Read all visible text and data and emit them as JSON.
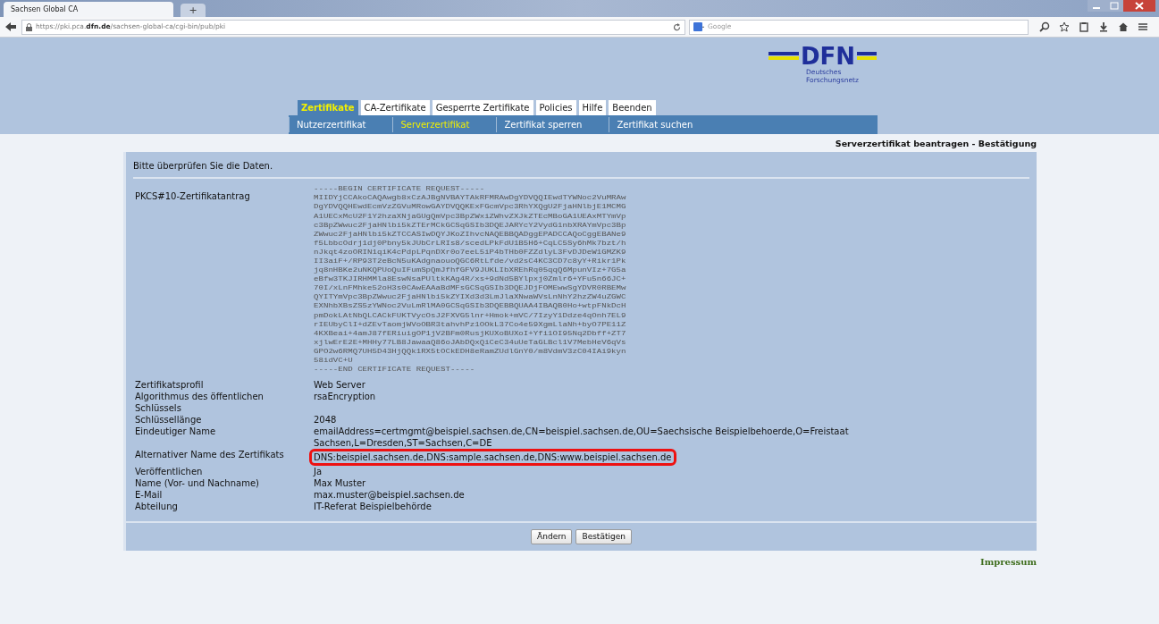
{
  "browser": {
    "tab_title": "Sachsen Global CA",
    "new_tab": "+",
    "url_prefix": "https://pki.pca.",
    "url_domain": "dfn.de",
    "url_path": "/sachsen-global-ca/cgi-bin/pub/pki",
    "search_placeholder": "Google"
  },
  "logo": {
    "name": "DFN",
    "subtitle_1": "Deutsches",
    "subtitle_2": "Forschungsnetz"
  },
  "tabs": [
    {
      "label": "Zertifikate",
      "selected": true
    },
    {
      "label": "CA-Zertifikate",
      "selected": false
    },
    {
      "label": "Gesperrte Zertifikate",
      "selected": false
    },
    {
      "label": "Policies",
      "selected": false
    },
    {
      "label": "Hilfe",
      "selected": false
    },
    {
      "label": "Beenden",
      "selected": false
    }
  ],
  "subtabs": [
    {
      "label": "Nutzerzertifikat",
      "selected": false
    },
    {
      "label": "Serverzertifikat",
      "selected": true
    },
    {
      "label": "Zertifikat sperren",
      "selected": false
    },
    {
      "label": "Zertifikat suchen",
      "selected": false
    }
  ],
  "page_title": "Serverzertifikat beantragen - Bestätigung",
  "instruction": "Bitte überprüfen Sie die Daten.",
  "request": {
    "label": "PKCS#10-Zertifikatantrag",
    "lines": [
      "-----BEGIN CERTIFICATE REQUEST-----",
      "MIIDYjCCAkoCAQAwgb8xCzAJBgNVBAYTAkRFMRAwDgYDVQQIEwdTYWNoc2VuMRAw",
      "DgYDVQQHEwdEcmVzZGVuMRowGAYDVQQKExFGcmVpc3RhYXQgU2FjaHNlbjE1MCMG",
      "A1UECxMcU2F1Y2hzaXNjaGUgQmVpc3BpZWxiZWhvZXJkZTEcMBoGA1UEAxMTYmVp",
      "c3BpZWwuc2FjaHNlbi5kZTErMCkGCSqGSIb3DQEJARYcY2VydG1nbXRAYmVpc3Bp",
      "ZWwuc2FjaHNlbi5kZTCCASIwDQYJKoZIhvcNAQEBBQADggEPADCCAQoCggEBANe9",
      "f5LbbcOdrj1dj0Pbny5kJUbCrLRIs8/scedLPkFdU1B5H6+CqLC5Sy6hMk7bzt/h",
      "nJkqt4zoORIN1qiK4cPdpLPqnDXr0o7eeL5iP4bTHb0FZZdlyL3FvDJDeW1GMZK9",
      "II3aiF+/RP93T2eBcN5uKAdgnaouoQGC6RtLfde/vd2sC4KC3CD7c8yY+Rikr1Pk",
      "jq8nHBKe2uNKQPUoQuIFumSpQmJfhfGFV9JUKLIbXREhRq05qqQ6MpunVIz+7G5a",
      "eBfw3TKJIRHMMla8EswNsaPUltkKAg4R/xs+9dNd5BYlpxj0Zmlr6+YFu5n66JC+",
      "70I/xLnFMhke52oH3s0CAwEAAaBdMFsGCSqGSIb3DQEJDjFOMEwwSgYDVR0RBEMw",
      "QYITYmVpc3BpZWwuc2FjaHNlbi5kZYIXd3d3LmJlaXNwaWVsLnNhY2hzZW4uZGWC",
      "EXNhbXBsZS5zYWNoc2VuLmRlMA0GCSqGSIb3DQEBBQUAA4IBAQB0Ho+wtpFNkDcH",
      "pmDokLAtNbQLCACkFUKTVycOsJ2FXVG5lnr+Hmok+mVC/7IzyY1Ddze4qOnh7EL9",
      "rIEUbyClI+dZEvTaomjWVoOBR3tahvhPz1OOkL37Co4e59XgmLlaNh+byO7PE11Z",
      "4KXBeai+4amJ87fERiuigOP1jV2BFm0RusjKUXoBUXoI+Yfi1OI95Nq2Dbff+ZT7",
      "xjlwErE2E+MHHy77LB8JawaaQ86oJAbDQxQiCeC34uUeTaGLBcl1V7MebHeV6qVs",
      "GPO2w6RMQ7UH5D43HjQQk1RX5tOCkEDH8eRamZUdlGnY0/m8VdmV3zC04IAi9kyn",
      "58idVC+U",
      "-----END CERTIFICATE REQUEST-----"
    ]
  },
  "fields": [
    {
      "label": "Zertifikatsprofil",
      "value": "Web Server",
      "highlighted": false
    },
    {
      "label": "Algorithmus des öffentlichen Schlüssels",
      "value": "rsaEncryption",
      "highlighted": false
    },
    {
      "label": "Schlüssellänge",
      "value": "2048",
      "highlighted": false
    },
    {
      "label": "Eindeutiger Name",
      "value": "emailAddress=certmgmt@beispiel.sachsen.de,CN=beispiel.sachsen.de,OU=Saechsische Beispielbehoerde,O=Freistaat Sachsen,L=Dresden,ST=Sachsen,C=DE",
      "highlighted": false
    },
    {
      "label": "Alternativer Name des Zertifikats",
      "value": "DNS:beispiel.sachsen.de,DNS:sample.sachsen.de,DNS:www.beispiel.sachsen.de",
      "highlighted": true
    },
    {
      "label": "Veröffentlichen",
      "value": "Ja",
      "highlighted": false
    },
    {
      "label": "Name (Vor- und Nachname)",
      "value": "Max Muster",
      "highlighted": false
    },
    {
      "label": "E-Mail",
      "value": "max.muster@beispiel.sachsen.de",
      "highlighted": false
    },
    {
      "label": "Abteilung",
      "value": "IT-Referat Beispielbehörde",
      "highlighted": false
    }
  ],
  "buttons": [
    "Ändern",
    "Bestätigen"
  ],
  "footer_link": "Impressum"
}
